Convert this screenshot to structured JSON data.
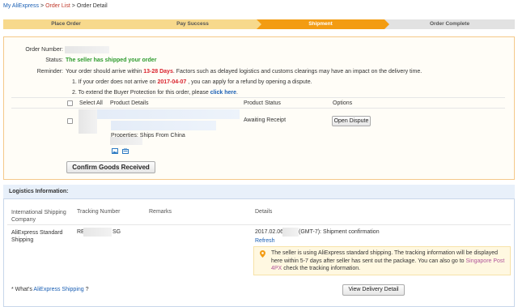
{
  "breadcrumb": {
    "root": "My AliExpress",
    "middle": "Order List",
    "current": "Order Detail",
    "sep": ">"
  },
  "steps": [
    {
      "label": "Place Order",
      "state": "done"
    },
    {
      "label": "Pay Success",
      "state": "done"
    },
    {
      "label": "Shipment",
      "state": "active"
    },
    {
      "label": "Order Complete",
      "state": "todo"
    }
  ],
  "order": {
    "number_label": "Order Number:",
    "status_label": "Status:",
    "status_value": "The seller has shipped your order",
    "reminder_label": "Reminder:",
    "reminder_pre": "Your order should arrive within",
    "reminder_days": "13-28 Days",
    "reminder_post": ". Factors such as delayed logistics and customs clearings may have an impact on the delivery time.",
    "note1_pre": "1. If your order does not arrive on",
    "note1_date": "2017-04-07",
    "note1_post": ", you can apply for a refund by opening a dispute.",
    "note2_pre": "2. To extend the Buyer Protection for this order, please",
    "note2_link": "click here",
    "note2_post": "."
  },
  "table": {
    "select_all": "Select All",
    "col_details": "Product Details",
    "col_status": "Product Status",
    "col_options": "Options",
    "row_status": "Awaiting Receipt",
    "row_button": "Open Dispute",
    "row_properties": "Properties: Ships From China"
  },
  "confirm_button": "Confirm Goods Received",
  "logistics": {
    "title": "Logistics Information:",
    "col_company": "International Shipping Company",
    "col_tracking": "Tracking Number",
    "col_remarks": "Remarks",
    "col_details": "Details",
    "company": "AliExpress Standard Shipping",
    "tracking_prefix": "RE",
    "tracking_suffix": "SG",
    "detail_date": "2017.02.06",
    "detail_text": "(GMT-7): Shipment confirmation",
    "refresh": "Refresh",
    "notice_text": "The seller is using AliExpress standard shipping. The tracking information will be displayed here within 5-7 days after seller has sent out the package. You can also go to",
    "notice_link": "Singapore Post 4PX",
    "notice_tail": "check the tracking information.",
    "whats_pre": "* What's",
    "whats_link": "AliExpress Shipping",
    "whats_post": "?",
    "view_button": "View Delivery Detail"
  },
  "colors": {
    "accent": "#f39c12",
    "step_done": "#f7d98c",
    "status_green": "#2e9b2e",
    "warning_red": "#d9232e",
    "link_blue": "#1a5fb4"
  }
}
